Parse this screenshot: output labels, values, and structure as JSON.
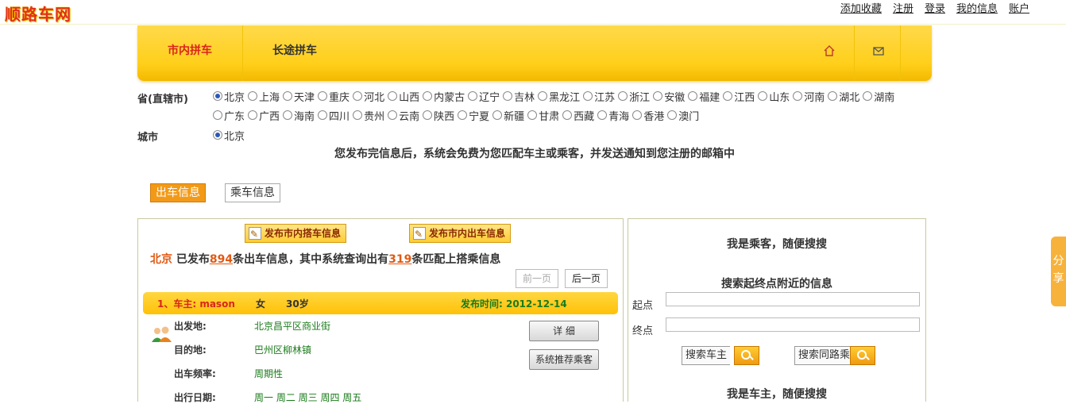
{
  "logo": "顺路车网",
  "top_links": [
    "添加收藏",
    "注册",
    "登录",
    "我的信息",
    "账户"
  ],
  "nav": {
    "tab_city": "市内拼车",
    "tab_long": "长途拼车",
    "home_icon": "home-icon",
    "mail_icon": "mail-icon"
  },
  "province_label": "省(直辖市)",
  "provinces": [
    "北京",
    "上海",
    "天津",
    "重庆",
    "河北",
    "山西",
    "内蒙古",
    "辽宁",
    "吉林",
    "黑龙江",
    "江苏",
    "浙江",
    "安徽",
    "福建",
    "江西",
    "山东",
    "河南",
    "湖北",
    "湖南",
    "广东",
    "广西",
    "海南",
    "四川",
    "贵州",
    "云南",
    "陕西",
    "宁夏",
    "新疆",
    "甘肃",
    "西藏",
    "青海",
    "香港",
    "澳门"
  ],
  "selected_province": "北京",
  "city_label": "城市",
  "cities": [
    "北京"
  ],
  "notice": "您发布完信息后，系统会免费为您匹配车主或乘客，并发送通知到您注册的邮箱中",
  "subtabs": [
    "出车信息",
    "乘车信息"
  ],
  "left": {
    "publish_ride": "发布市内搭车信息",
    "publish_drive": "发布市内出车信息",
    "summary": {
      "city": "北京",
      "t1": "已发布",
      "count": "894",
      "t2": "条出车信息，其中系统查询出有",
      "matched": "319",
      "t3": "条匹配上搭乘信息"
    },
    "prev_page": "前一页",
    "next_page": "后一页",
    "entry": {
      "owner": "1、车主: mason",
      "gender": "女",
      "age": "30岁",
      "publish_time": "发布时间: 2012-12-14",
      "from_label": "出发地:",
      "from": "北京昌平区商业街",
      "to_label": "目的地:",
      "to": "巴州区柳林镇",
      "freq_label": "出车频率:",
      "freq": "周期性",
      "date_label": "出行日期:",
      "date": "周一 周二 周三 周四 周五",
      "detail_btn": "详  细",
      "recommend_btn": "系统推荐乘客"
    }
  },
  "right": {
    "title_passenger": "我是乘客，随便搜搜",
    "title_search": "搜索起终点附近的信息",
    "start_label": "起点",
    "end_label": "终点",
    "search_owner": "搜索车主",
    "search_passenger": "搜索同路乘客",
    "title_owner": "我是车主，随便搜搜"
  },
  "share": "分享",
  "colors": {
    "accent": "#ffcc1a",
    "highlight": "#e05a14",
    "green_text": "#1a7a1a",
    "active_tab": "#f29a18"
  }
}
